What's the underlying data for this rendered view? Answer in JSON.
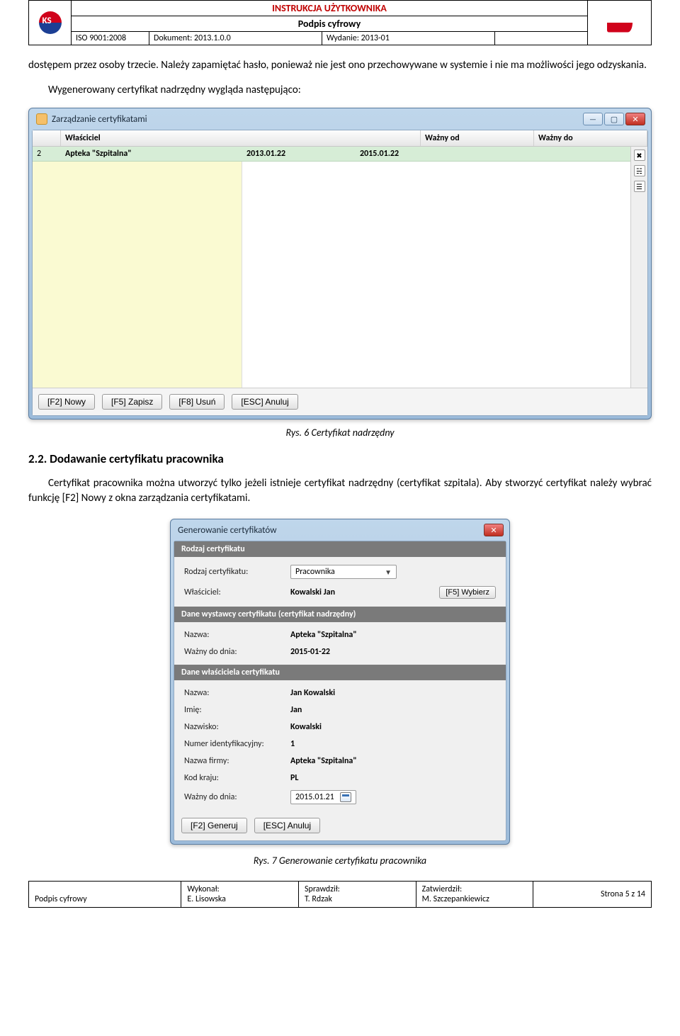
{
  "doc_header": {
    "title": "INSTRUKCJA UŻYTKOWNIKA",
    "subtitle": "Podpis cyfrowy",
    "iso": "ISO 9001:2008",
    "doc_label": "Dokument: 2013.1.0.0",
    "issue": "Wydanie: 2013-01",
    "logo_text": "KS"
  },
  "body": {
    "p1": "dostępem przez osoby trzecie. Należy zapamiętać hasło, ponieważ nie jest ono przechowywane w systemie i nie ma możliwości jego odzyskania.",
    "p2": "Wygenerowany certyfikat nadrzędny wygląda następująco:",
    "fig6_caption": "Rys. 6   Certyfikat nadrzędny",
    "section_22": "2.2. Dodawanie certyfikatu pracownika",
    "p3": "Certyfikat pracownika można utworzyć tylko jeżeli istnieje certyfikat nadrzędny (certyfikat szpitala). Aby stworzyć certyfikat należy wybrać funkcję [F2] Nowy z okna zarządzania certyfikatami.",
    "fig7_caption": "Rys. 7   Generowanie certyfikatu pracownika"
  },
  "cert_window": {
    "title": "Zarządzanie certyfikatami",
    "columns": {
      "owner": "Właściciel",
      "from": "Ważny od",
      "to": "Ważny do"
    },
    "row": {
      "num": "2",
      "owner": "Apteka \"Szpitalna\"",
      "from": "2013.01.22",
      "to": "2015.01.22"
    },
    "buttons": {
      "f2": "[F2] Nowy",
      "f5": "[F5] Zapisz",
      "f8": "[F8] Usuń",
      "esc": "[ESC] Anuluj"
    }
  },
  "gen_dialog": {
    "title": "Generowanie certyfikatów",
    "sec1": "Rodzaj certyfikatu",
    "kind_label": "Rodzaj certyfikatu:",
    "kind_value": "Pracownika",
    "owner_label": "Właściciel:",
    "owner_value": "Kowalski Jan",
    "f5_pick": "[F5] Wybierz",
    "sec2": "Dane wystawcy certyfikatu (certyfikat nadrzędny)",
    "issuer_name_label": "Nazwa:",
    "issuer_name_value": "Apteka \"Szpitalna\"",
    "issuer_valid_label": "Ważny do dnia:",
    "issuer_valid_value": "2015-01-22",
    "sec3": "Dane właściciela certyfikatu",
    "o_name_label": "Nazwa:",
    "o_name_value": "Jan Kowalski",
    "o_first_label": "Imię:",
    "o_first_value": "Jan",
    "o_last_label": "Nazwisko:",
    "o_last_value": "Kowalski",
    "o_id_label": "Numer identyfikacyjny:",
    "o_id_value": "1",
    "o_company_label": "Nazwa firmy:",
    "o_company_value": "Apteka \"Szpitalna\"",
    "o_country_label": "Kod kraju:",
    "o_country_value": "PL",
    "o_valid_label": "Ważny do dnia:",
    "o_valid_value": "2015.01.21",
    "btn_gen": "[F2] Generuj",
    "btn_cancel": "[ESC] Anuluj"
  },
  "doc_footer": {
    "left": "Podpis cyfrowy",
    "c1a": "Wykonał:",
    "c1b": "E. Lisowska",
    "c2a": "Sprawdził:",
    "c2b": "T. Rdzak",
    "c3a": "Zatwierdził:",
    "c3b": "M. Szczepankiewicz",
    "page": "Strona 5 z 14"
  }
}
